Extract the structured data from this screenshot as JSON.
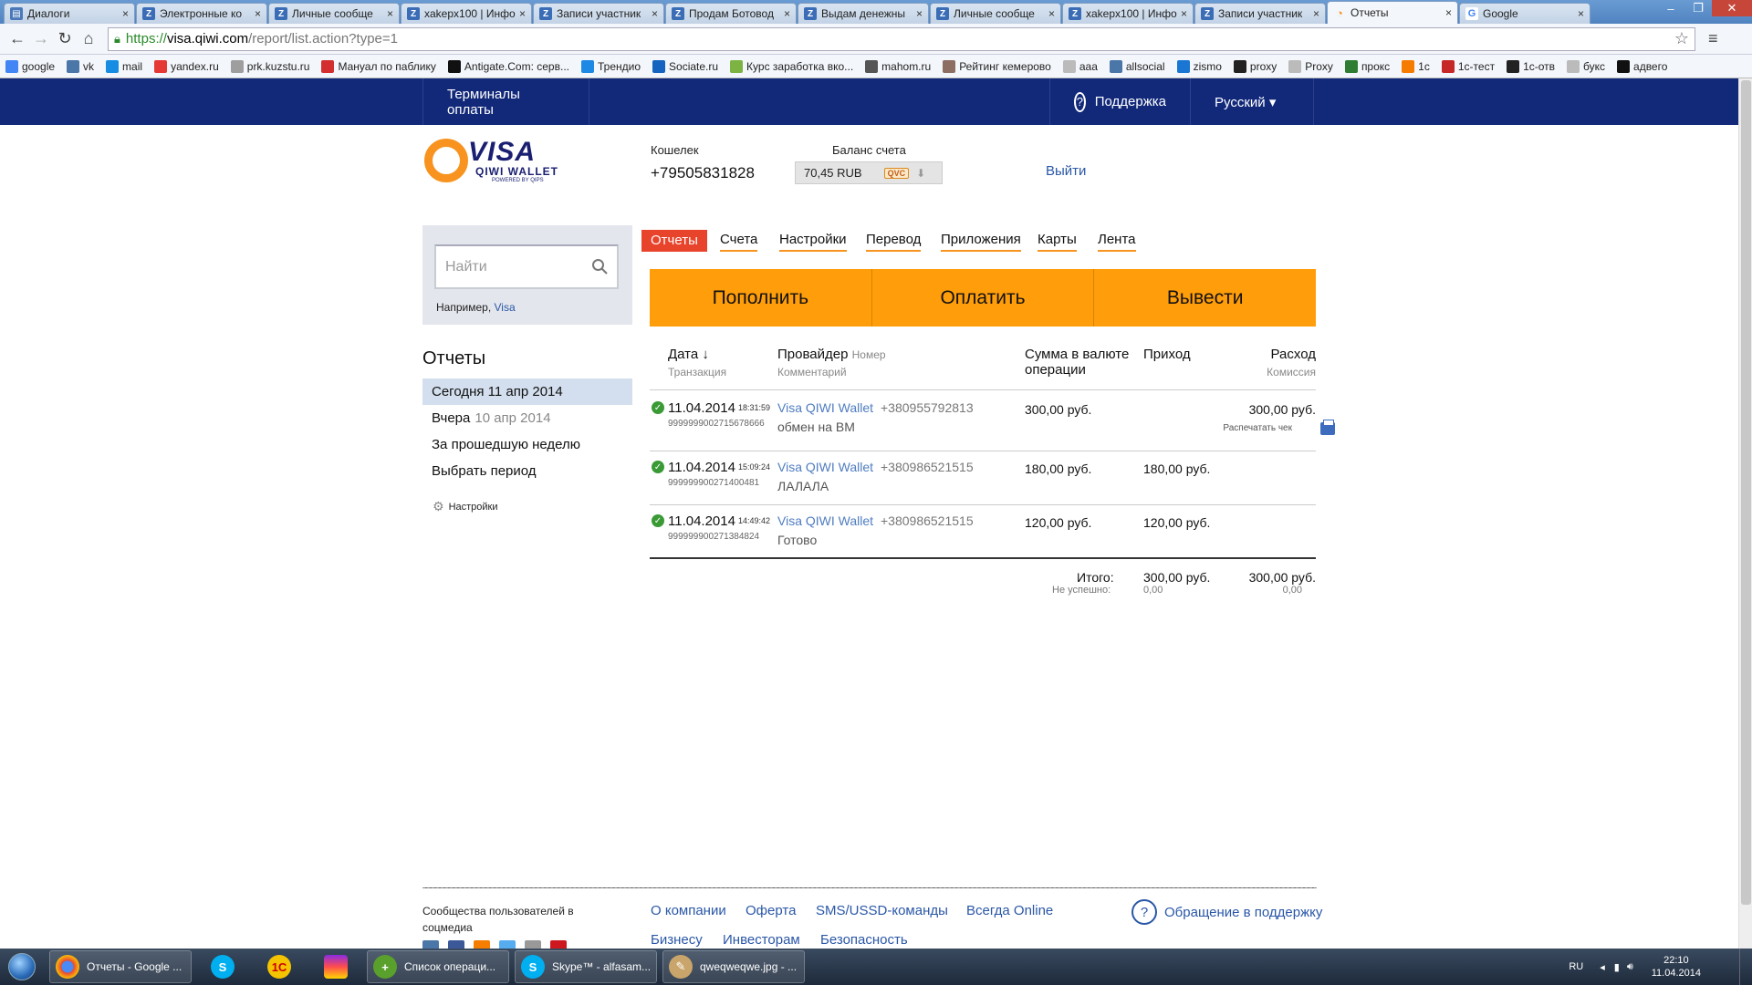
{
  "browser": {
    "tabs": [
      {
        "label": "Диалоги",
        "icon": "vk-dialogs-icon"
      },
      {
        "label": "Электронные ко",
        "icon": "zismo-icon"
      },
      {
        "label": "Личные сообще",
        "icon": "zismo-icon"
      },
      {
        "label": "xakepx100 | Инфо",
        "icon": "zismo-icon"
      },
      {
        "label": "Записи участник",
        "icon": "zismo-icon"
      },
      {
        "label": "Продам Ботовод",
        "icon": "zismo-icon"
      },
      {
        "label": "Выдам денежны",
        "icon": "zismo-icon"
      },
      {
        "label": "Личные сообще",
        "icon": "zismo-icon"
      },
      {
        "label": "xakepx100 | Инфо",
        "icon": "zismo-icon"
      },
      {
        "label": "Записи участник",
        "icon": "zismo-icon"
      },
      {
        "label": "Отчеты",
        "icon": "qiwi-icon",
        "active": true
      },
      {
        "label": "Google",
        "icon": "google-icon"
      }
    ],
    "url": {
      "scheme": "https://",
      "host": "visa.qiwi.com",
      "path": "/report/list.action?type=1"
    },
    "bookmarks": [
      "google",
      "vk",
      "mail",
      "yandex.ru",
      "prk.kuzstu.ru",
      "Мануал по паблику",
      "Antigate.Com: серв...",
      "Трендио",
      "Sociate.ru",
      "Курс заработка вко...",
      "mahom.ru",
      "Рейтинг кемерово",
      "aaa",
      "allsocial",
      "zismo",
      "proxy",
      "Proxy",
      "прокс",
      "1с",
      "1с-тест",
      "1с-отв",
      "букс",
      "адвего"
    ],
    "tab_close": "×",
    "win_controls": [
      "–",
      "❐",
      "✕"
    ]
  },
  "site": {
    "top_nav": {
      "terminals": "Терминалы оплаты",
      "support": "Поддержка",
      "language": "Русский ▾"
    },
    "logo": {
      "visa": "VISA",
      "qiwi": "QIWI WALLET",
      "powered": "POWERED BY QIPS"
    },
    "wallet": {
      "label": "Кошелек",
      "number": "+79505831828"
    },
    "balance": {
      "label": "Баланс счета",
      "value": "70,45 RUB",
      "badge": "QVC"
    },
    "logout": "Выйти",
    "search": {
      "placeholder": "Найти",
      "hint_prefix": "Например, ",
      "hint_link": "Visa"
    },
    "reports": {
      "title": "Отчеты",
      "periods": [
        {
          "label": "Сегодня 11 апр 2014",
          "dim": "",
          "selected": true
        },
        {
          "label": "Вчера",
          "dim": "10 апр 2014",
          "selected": false
        },
        {
          "label": "За прошедшую неделю",
          "dim": "",
          "selected": false
        },
        {
          "label": "Выбрать период",
          "dim": "",
          "selected": false
        }
      ],
      "settings": "Настройки"
    },
    "main_tabs": [
      "Отчеты",
      "Счета",
      "Настройки",
      "Перевод",
      "Приложения",
      "Карты",
      "Лента"
    ],
    "actions": [
      "Пополнить",
      "Оплатить",
      "Вывести"
    ],
    "table": {
      "headers": {
        "date": "Дата ↓",
        "date_sub": "Транзакция",
        "provider": "Провайдер",
        "provider_num": "Номер",
        "provider_sub": "Комментарий",
        "amount": "Сумма в валюте операции",
        "income": "Приход",
        "expense": "Расход",
        "expense_sub": "Комиссия"
      },
      "rows": [
        {
          "date": "11.04.2014",
          "time": "18:31:59",
          "tid": "9999999002715678666",
          "provider": "Visa QIWI Wallet",
          "number": "+380955792813",
          "comment": "обмен на ВМ",
          "amount": "300,00 руб.",
          "income": "",
          "expense": "300,00 руб.",
          "print": "Распечатать чек"
        },
        {
          "date": "11.04.2014",
          "time": "15:09:24",
          "tid": "999999900271400481",
          "provider": "Visa QIWI Wallet",
          "number": "+380986521515",
          "comment": "ЛАЛАЛА",
          "amount": "180,00 руб.",
          "income": "180,00 руб.",
          "expense": "",
          "print": ""
        },
        {
          "date": "11.04.2014",
          "time": "14:49:42",
          "tid": "999999900271384824",
          "provider": "Visa QIWI Wallet",
          "number": "+380986521515",
          "comment": "Готово",
          "amount": "120,00 руб.",
          "income": "120,00 руб.",
          "expense": "",
          "print": ""
        }
      ],
      "totals": {
        "label": "Итого:",
        "failed_label": "Не успешно:",
        "income": "300,00 руб.",
        "expense": "300,00 руб.",
        "income_failed": "0,00",
        "expense_failed": "0,00"
      }
    },
    "footer": {
      "communities": "Сообщества пользователей в соцмедиа",
      "links_row1": [
        "О компании",
        "Оферта",
        "SMS/USSD-команды",
        "Всегда Online"
      ],
      "links_row2": [
        "Бизнесу",
        "Инвесторам",
        "Безопасность"
      ],
      "support": "Обращение в поддержку"
    },
    "colors": {
      "header": "#12297a",
      "accent": "#ff9d0a",
      "active_tab": "#e8432b",
      "link": "#4f7dc0"
    }
  },
  "taskbar": {
    "items": [
      {
        "label": "Отчеты - Google ...",
        "icon": "chrome-icon"
      },
      {
        "label": "",
        "icon": "skype-icon"
      },
      {
        "label": "",
        "icon": "1c-icon"
      },
      {
        "label": "",
        "icon": "winrar-icon"
      },
      {
        "label": "Список операци...",
        "icon": "app-add-icon"
      },
      {
        "label": "Skype™ - alfasam...",
        "icon": "skype-icon"
      },
      {
        "label": "qweqweqwe.jpg - ...",
        "icon": "paint-icon"
      }
    ],
    "lang": "RU",
    "time": "22:10",
    "date": "11.04.2014"
  }
}
